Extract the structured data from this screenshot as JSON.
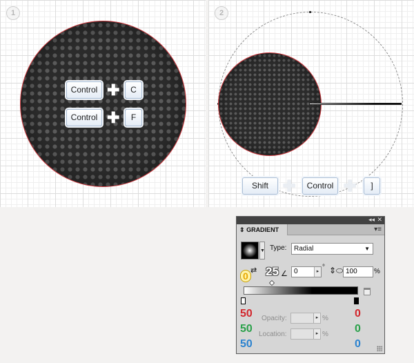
{
  "steps": {
    "one": "1",
    "two": "2"
  },
  "step1_keys": {
    "row1_key1": "Control",
    "row1_key2": "C",
    "row2_key1": "Control",
    "row2_key2": "F"
  },
  "step2_keys": {
    "key1": "Shift",
    "key2": "Control",
    "key3": "]"
  },
  "plus_glyph": "✚",
  "gradient_panel": {
    "tab_title": "GRADIENT",
    "type_label": "Type:",
    "type_value": "Radial",
    "angle_value": "0",
    "degree_symbol": "°",
    "aspect_value": "100",
    "percent": "%",
    "opacity_label": "Opacity:",
    "location_label": "Location:"
  },
  "annotations": {
    "yellow_zero": "0",
    "outlined_25": "25",
    "left_red": "50",
    "left_green": "50",
    "left_blue": "50",
    "right_red": "0",
    "right_green": "0",
    "right_blue": "0"
  },
  "colors": {
    "accent_red": "#d2272d",
    "accent_green": "#2aa14a",
    "accent_blue": "#2c83cf",
    "sphere_outline": "#c9353a"
  }
}
